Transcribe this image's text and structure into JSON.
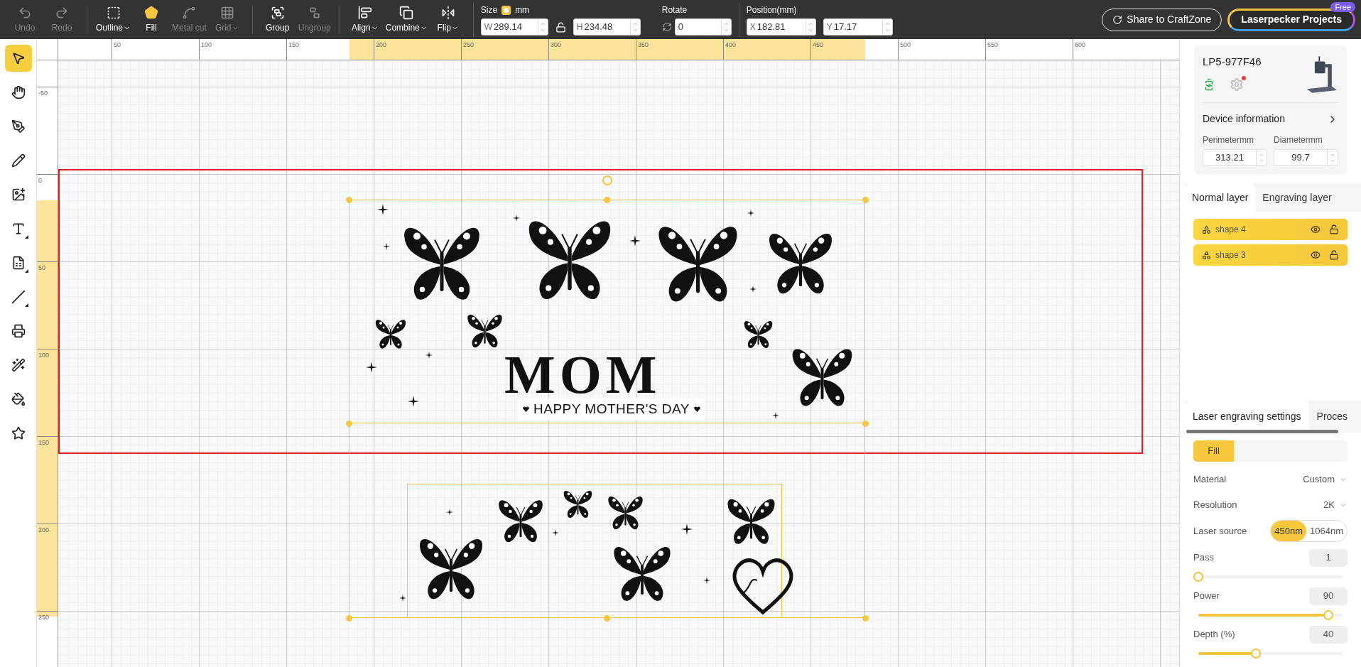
{
  "toolbar": {
    "groups": [
      [
        {
          "label": "Undo",
          "disabled": true,
          "dropdown": false
        },
        {
          "label": "Redo",
          "disabled": true,
          "dropdown": false
        }
      ],
      [
        {
          "label": "Outline",
          "disabled": false,
          "dropdown": true
        },
        {
          "label": "Fill",
          "disabled": false,
          "dropdown": false
        },
        {
          "label": "Metal cut",
          "disabled": true,
          "dropdown": false
        },
        {
          "label": "Grid",
          "disabled": true,
          "dropdown": true
        }
      ],
      [
        {
          "label": "Group",
          "disabled": false,
          "dropdown": false
        },
        {
          "label": "Ungroup",
          "disabled": true,
          "dropdown": false
        }
      ],
      [
        {
          "label": "Align",
          "disabled": false,
          "dropdown": true
        },
        {
          "label": "Combine",
          "disabled": false,
          "dropdown": true
        },
        {
          "label": "Flip",
          "disabled": false,
          "dropdown": true
        }
      ]
    ],
    "size": {
      "label": "Size",
      "unit": "mm",
      "unit_toggle_on": true,
      "width": {
        "prefix": "W",
        "value": "289.14"
      },
      "height": {
        "prefix": "H",
        "value": "234.48"
      }
    },
    "rotate": {
      "label": "Rotate",
      "value": "0"
    },
    "position": {
      "label": "Position(mm)",
      "x": {
        "prefix": "X",
        "value": "182.81"
      },
      "y": {
        "prefix": "Y",
        "value": "17.17"
      }
    },
    "share_button": "Share to CraftZone",
    "projects_button": {
      "label": "Laserpecker Projects",
      "badge": "Free"
    }
  },
  "tools": [
    {
      "selected": true,
      "submenu": false
    },
    {
      "selected": false,
      "submenu": false
    },
    {
      "selected": false,
      "submenu": false
    },
    {
      "selected": false,
      "submenu": false
    },
    {
      "selected": false,
      "submenu": false
    },
    {
      "selected": false,
      "submenu": true
    },
    {
      "selected": false,
      "submenu": true
    },
    {
      "selected": false,
      "submenu": true
    },
    {
      "selected": false,
      "submenu": false
    },
    {
      "selected": false,
      "submenu": false
    },
    {
      "selected": false,
      "submenu": false
    },
    {
      "selected": false,
      "submenu": false
    }
  ],
  "rulers": {
    "horizontal": [
      "50",
      "100",
      "150",
      "200",
      "250",
      "300",
      "350",
      "400",
      "450",
      "500",
      "550",
      "600"
    ],
    "vertical": [
      "-50",
      "0",
      "50",
      "100",
      "150",
      "200",
      "250"
    ]
  },
  "canvas": {
    "design": {
      "title": "MOM",
      "subtitle": "HAPPY MOTHER'S DAY"
    }
  },
  "device": {
    "name": "LP5-977F46",
    "connected": true,
    "notification": true,
    "info_link": "Device information",
    "perimeter": {
      "label": "Perimetermm",
      "value": "313.21"
    },
    "diameter": {
      "label": "Diametermm",
      "value": "99.7"
    }
  },
  "layer_tabs": [
    {
      "label": "Normal layer",
      "selected": true
    },
    {
      "label": "Engraving layer",
      "selected": false
    }
  ],
  "layers": [
    {
      "name": "shape 4"
    },
    {
      "name": "shape 3"
    }
  ],
  "settings_tabs": [
    {
      "label": "Laser engraving settings",
      "selected": true
    },
    {
      "label": "Proces",
      "selected": false
    }
  ],
  "modes": [
    {
      "label": "Fill",
      "selected": true
    }
  ],
  "settings": {
    "material": {
      "label": "Material",
      "value": "Custom"
    },
    "resolution": {
      "label": "Resolution",
      "value": "2K"
    },
    "laser_source": {
      "label": "Laser source",
      "options": [
        {
          "label": "450nm",
          "selected": true
        },
        {
          "label": "1064nm",
          "selected": false
        }
      ]
    },
    "sliders": [
      {
        "label": "Pass",
        "value": "1",
        "level": 0
      },
      {
        "label": "Power",
        "value": "90",
        "level": 0.9
      },
      {
        "label": "Depth (%)",
        "value": "40",
        "level": 0.4
      }
    ]
  }
}
